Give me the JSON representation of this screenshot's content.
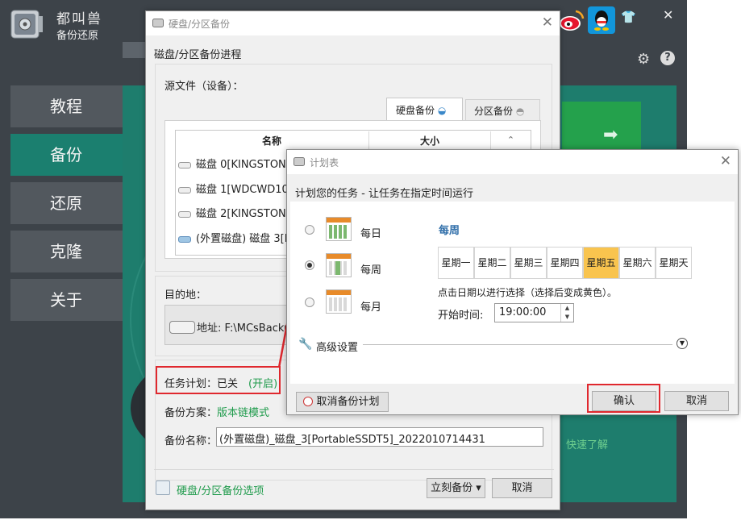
{
  "app": {
    "title_line1": "都叫兽",
    "title_line2": "备份还原",
    "fast_text": "快速了解"
  },
  "sidebar": {
    "items": [
      {
        "label": "教程",
        "active": false
      },
      {
        "label": "备份",
        "active": true
      },
      {
        "label": "还原",
        "active": false
      },
      {
        "label": "克隆",
        "active": false
      },
      {
        "label": "关于",
        "active": false
      }
    ]
  },
  "icons": {
    "weibo": "weibo-icon",
    "qq": "qq-icon",
    "shirt": "shirt-icon",
    "close": "close-icon",
    "settings": "gear-icon",
    "help": "help-icon"
  },
  "dialog_backup": {
    "title": "硬盘/分区备份",
    "heading": "磁盘/分区备份进程",
    "source_label": "源文件（设备）：",
    "tabs": [
      "硬盘备份",
      "分区备份"
    ],
    "table": {
      "headers": [
        "名称",
        "大小"
      ],
      "rows": [
        {
          "name": "磁盘 0[KINGSTON"
        },
        {
          "name": "磁盘 1[WDCWD10"
        },
        {
          "name": "磁盘 2[KINGSTON"
        },
        {
          "name": "(外置磁盘) 磁盘 3[P"
        }
      ]
    },
    "dest_label": "目的地：",
    "dest_value": "地址: F:\\MCsBacku",
    "schedule_label": "任务计划：已关",
    "schedule_link": "(开启)",
    "scheme_label": "备份方案：",
    "scheme_link": "版本链模式",
    "name_label": "备份名称：",
    "name_value": "(外置磁盘)_磁盘_3[PortableSSDT5]_2022010714431",
    "options_link": "硬盘/分区备份选项",
    "backup_now": "立刻备份 ▾",
    "cancel": "取消"
  },
  "dialog_schedule": {
    "title": "计划表",
    "heading": "计划您的任务 - 让任务在指定时间运行",
    "frequencies": [
      {
        "label": "每日",
        "checked": false
      },
      {
        "label": "每周",
        "checked": true
      },
      {
        "label": "每月",
        "checked": false
      }
    ],
    "weekly_title": "每周",
    "days": [
      "星期一",
      "星期二",
      "星期三",
      "星期四",
      "星期五",
      "星期六",
      "星期天"
    ],
    "selected_day": "星期五",
    "hint": "点击日期以进行选择（选择后变成黄色）。",
    "start_label": "开始时间:",
    "start_value": "19:00:00",
    "advanced_label": "高级设置",
    "cancel_plan": "取消备份计划",
    "ok": "确认",
    "cancel": "取消"
  },
  "colors": {
    "app_bg": "#3d4349",
    "sidebar_active": "#1b7f6f",
    "content_green": "#1e7d6d",
    "link_green": "#1d9a4a",
    "highlight_red": "#e0282e",
    "day_selected": "#f9c44e"
  }
}
